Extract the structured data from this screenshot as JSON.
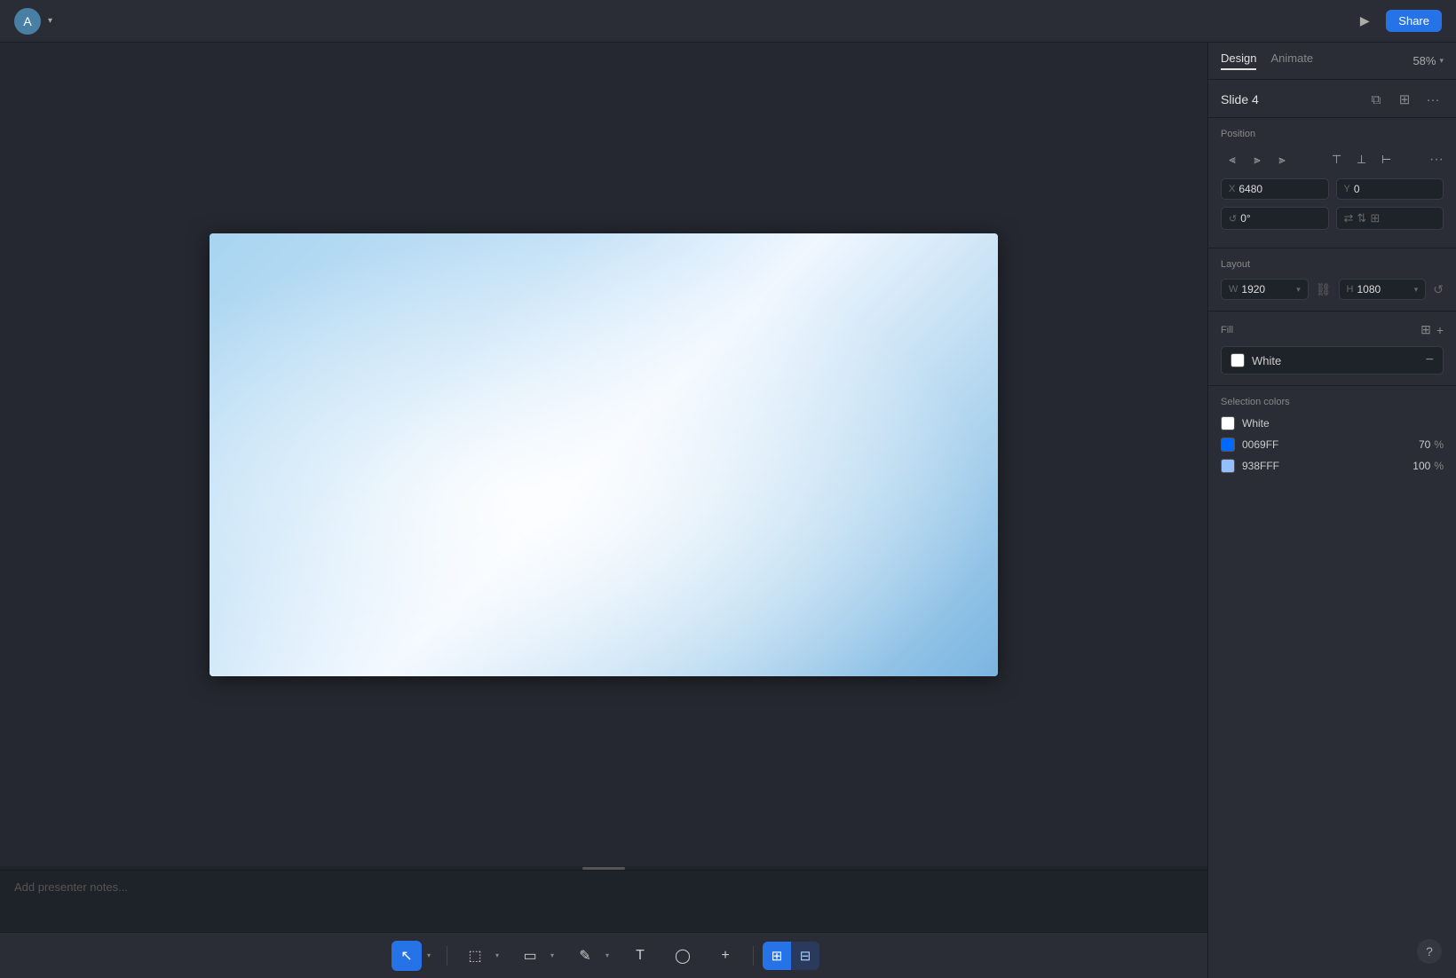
{
  "topbar": {
    "avatar_initial": "A",
    "share_label": "Share"
  },
  "panel": {
    "tabs": [
      {
        "id": "design",
        "label": "Design",
        "active": true
      },
      {
        "id": "animate",
        "label": "Animate",
        "active": false
      }
    ],
    "zoom": "58%",
    "slide_title": "Slide 4",
    "position": {
      "label": "Position",
      "x_label": "X",
      "x_value": "6480",
      "y_label": "Y",
      "y_value": "0",
      "angle_label": "↺",
      "angle_value": "0°"
    },
    "layout": {
      "label": "Layout",
      "w_label": "W",
      "w_value": "1920",
      "h_label": "H",
      "h_value": "1080"
    },
    "fill": {
      "label": "Fill",
      "color_name": "White",
      "color_hex": "#ffffff"
    },
    "selection_colors": {
      "label": "Selection colors",
      "colors": [
        {
          "hex": "#ffffff",
          "name": "White",
          "opacity": null,
          "opacity_pct": null
        },
        {
          "hex": "#0069ff",
          "name": "0069FF",
          "opacity": "70",
          "opacity_pct": "%"
        },
        {
          "hex": "#93bfff",
          "name": "938FFF",
          "opacity": "100",
          "opacity_pct": "%"
        }
      ]
    }
  },
  "notes": {
    "placeholder": "Add presenter notes..."
  },
  "toolbar": {
    "tools": [
      {
        "id": "cursor",
        "icon": "↖",
        "active": true
      },
      {
        "id": "frame",
        "icon": "⬜"
      },
      {
        "id": "shape",
        "icon": "▭"
      },
      {
        "id": "pen",
        "icon": "✏"
      },
      {
        "id": "text",
        "icon": "T"
      },
      {
        "id": "oval",
        "icon": "◯"
      },
      {
        "id": "plus",
        "icon": "+"
      }
    ]
  }
}
